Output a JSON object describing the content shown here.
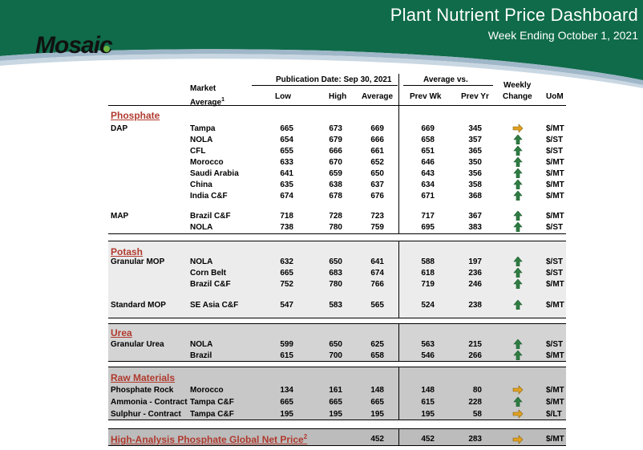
{
  "header": {
    "title": "Plant Nutrient Price Dashboard",
    "subtitle": "Week Ending October 1, 2021",
    "logo_text": "Mosaic"
  },
  "columns": {
    "publication_date": "Publication Date:  Sep 30, 2021",
    "average_vs": "Average  vs.",
    "market_average": "Market",
    "market_average_2": "Average",
    "market_average_sup": "1",
    "low": "Low",
    "high": "High",
    "average": "Average",
    "prev_wk": "Prev Wk",
    "prev_yr": "Prev Yr",
    "weekly": "Weekly",
    "change": "Change",
    "uom": "UoM"
  },
  "colors": {
    "banner": "#0f6b4a",
    "section_title": "#b03a2e",
    "arrow_up": "#2f7d43",
    "arrow_right": "#e0a020"
  },
  "sections": [
    {
      "title": "Phosphate",
      "rows": [
        {
          "product": "DAP",
          "market": "Tampa",
          "low": "665",
          "high": "673",
          "avg": "669",
          "prev_wk": "669",
          "prev_yr": "345",
          "change": "right",
          "uom": "$/MT"
        },
        {
          "product": "",
          "market": "NOLA",
          "low": "654",
          "high": "679",
          "avg": "666",
          "prev_wk": "658",
          "prev_yr": "357",
          "change": "up",
          "uom": "$/ST"
        },
        {
          "product": "",
          "market": "CFL",
          "low": "655",
          "high": "666",
          "avg": "661",
          "prev_wk": "651",
          "prev_yr": "365",
          "change": "up",
          "uom": "$/ST"
        },
        {
          "product": "",
          "market": "Morocco",
          "low": "633",
          "high": "670",
          "avg": "652",
          "prev_wk": "646",
          "prev_yr": "350",
          "change": "up",
          "uom": "$/MT"
        },
        {
          "product": "",
          "market": "Saudi Arabia",
          "low": "641",
          "high": "659",
          "avg": "650",
          "prev_wk": "643",
          "prev_yr": "356",
          "change": "up",
          "uom": "$/MT"
        },
        {
          "product": "",
          "market": "China",
          "low": "635",
          "high": "638",
          "avg": "637",
          "prev_wk": "634",
          "prev_yr": "358",
          "change": "up",
          "uom": "$/MT"
        },
        {
          "product": "",
          "market": "India C&F",
          "low": "674",
          "high": "678",
          "avg": "676",
          "prev_wk": "671",
          "prev_yr": "368",
          "change": "up",
          "uom": "$/MT"
        },
        {
          "product": "MAP",
          "market": "Brazil C&F",
          "low": "718",
          "high": "728",
          "avg": "723",
          "prev_wk": "717",
          "prev_yr": "367",
          "change": "up",
          "uom": "$/MT"
        },
        {
          "product": "",
          "market": "NOLA",
          "low": "738",
          "high": "780",
          "avg": "759",
          "prev_wk": "695",
          "prev_yr": "383",
          "change": "up",
          "uom": "$/ST"
        }
      ]
    },
    {
      "title": "Potash",
      "rows": [
        {
          "product": "Granular MOP",
          "market": "NOLA",
          "low": "632",
          "high": "650",
          "avg": "641",
          "prev_wk": "588",
          "prev_yr": "197",
          "change": "up",
          "uom": "$/ST"
        },
        {
          "product": "",
          "market": "Corn Belt",
          "low": "665",
          "high": "683",
          "avg": "674",
          "prev_wk": "618",
          "prev_yr": "236",
          "change": "up",
          "uom": "$/ST"
        },
        {
          "product": "",
          "market": "Brazil C&F",
          "low": "752",
          "high": "780",
          "avg": "766",
          "prev_wk": "719",
          "prev_yr": "246",
          "change": "up",
          "uom": "$/MT"
        },
        {
          "product": "Standard MOP",
          "market": "SE Asia C&F",
          "low": "547",
          "high": "583",
          "avg": "565",
          "prev_wk": "524",
          "prev_yr": "238",
          "change": "up",
          "uom": "$/MT"
        }
      ]
    },
    {
      "title": "Urea",
      "rows": [
        {
          "product": "Granular Urea",
          "market": "NOLA",
          "low": "599",
          "high": "650",
          "avg": "625",
          "prev_wk": "563",
          "prev_yr": "215",
          "change": "up",
          "uom": "$/ST"
        },
        {
          "product": "",
          "market": "Brazil",
          "low": "615",
          "high": "700",
          "avg": "658",
          "prev_wk": "546",
          "prev_yr": "266",
          "change": "up",
          "uom": "$/MT"
        }
      ]
    },
    {
      "title": "Raw Materials",
      "rows": [
        {
          "product": "Phosphate Rock",
          "market": "Morocco",
          "low": "134",
          "high": "161",
          "avg": "148",
          "prev_wk": "148",
          "prev_yr": "80",
          "change": "right",
          "uom": "$/MT"
        },
        {
          "product": "Ammonia - Contract",
          "market": "Tampa C&F",
          "low": "665",
          "high": "665",
          "avg": "665",
          "prev_wk": "615",
          "prev_yr": "228",
          "change": "up",
          "uom": "$/MT"
        },
        {
          "product": "Sulphur - Contract",
          "market": "Tampa C&F",
          "low": "195",
          "high": "195",
          "avg": "195",
          "prev_wk": "195",
          "prev_yr": "58",
          "change": "right",
          "uom": "$/LT"
        }
      ]
    }
  ],
  "net_price": {
    "label": "High-Analysis Phosphate Global Net Price",
    "sup": "2",
    "avg": "452",
    "prev_wk": "452",
    "prev_yr": "283",
    "change": "right",
    "uom": "$/MT"
  }
}
